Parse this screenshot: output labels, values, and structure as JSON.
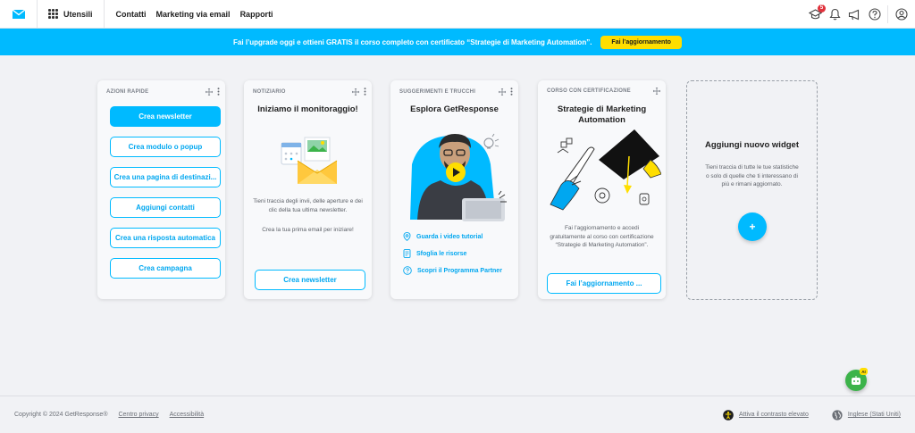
{
  "header": {
    "apps_label": "Utensili",
    "nav": [
      "Contatti",
      "Marketing via email",
      "Rapporti"
    ],
    "notifications_count": "5"
  },
  "banner": {
    "text": "Fai l’upgrade oggi e ottieni GRATIS il corso completo con certificato “Strategie di Marketing Automation”.",
    "button": "Fai l’aggiornamento"
  },
  "quick_actions": {
    "label": "AZIONI RAPIDE",
    "buttons": [
      "Crea newsletter",
      "Crea modulo o popup",
      "Crea una pagina di destinazi...",
      "Aggiungi contatti",
      "Crea una risposta automatica",
      "Crea campagna"
    ]
  },
  "newsroom": {
    "label": "NOTIZIARIO",
    "title": "Iniziamo il monitoraggio!",
    "text1": "Tieni traccia degli invii, delle aperture e dei clic della tua ultima newsletter.",
    "text2": "Crea la tua prima email per iniziare!",
    "button": "Crea newsletter"
  },
  "tips": {
    "label": "SUGGERIMENTI E TRUCCHI",
    "title": "Esplora GetResponse",
    "links": [
      "Guarda i video tutorial",
      "Sfoglia le risorse",
      "Scopri il Programma Partner"
    ]
  },
  "course": {
    "label": "CORSO CON CERTIFICAZIONE",
    "title": "Strategie di Marketing Automation",
    "text": "Fai l’aggiornamento e accedi gratuitamente al corso con certificazione “Strategie di Marketing Automation”.",
    "button": "Fai l’aggiornamento ..."
  },
  "add_widget": {
    "title": "Aggiungi nuovo widget",
    "text": "Tieni traccia di tutte le tue statistiche o solo di quelle che ti interessano di più e rimani aggiornato.",
    "button": "+"
  },
  "footer": {
    "copyright": "Copyright © 2024 GetResponse®",
    "privacy": "Centro privacy",
    "accessibility": "Accessibilità",
    "contrast": "Attiva il contrasto elevato",
    "language": "Inglese (Stati Uniti)"
  },
  "chatbot": {
    "badge": "AI"
  },
  "colors": {
    "accent": "#00baff",
    "banner_button": "#ffde00",
    "badge": "#e0323c",
    "chatbot": "#3cb34a"
  }
}
